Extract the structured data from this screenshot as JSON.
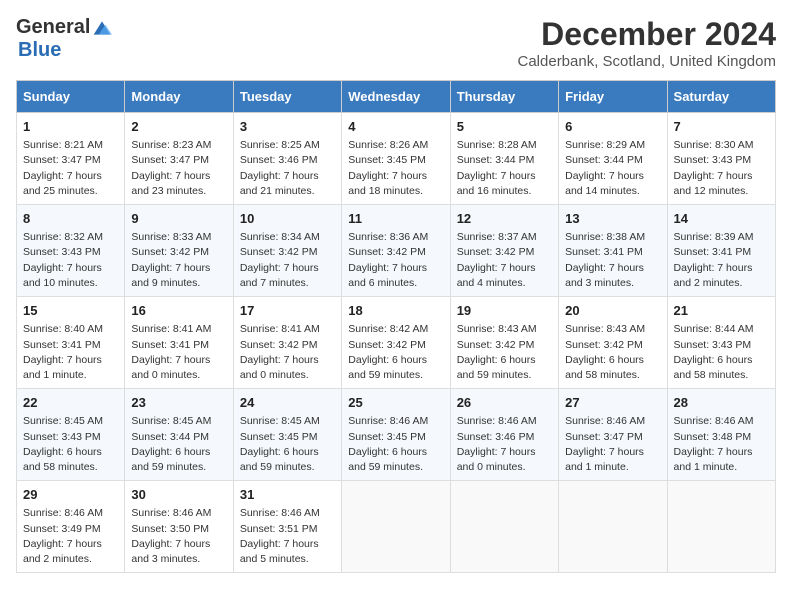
{
  "header": {
    "logo_general": "General",
    "logo_blue": "Blue",
    "month_title": "December 2024",
    "location": "Calderbank, Scotland, United Kingdom"
  },
  "calendar": {
    "columns": [
      "Sunday",
      "Monday",
      "Tuesday",
      "Wednesday",
      "Thursday",
      "Friday",
      "Saturday"
    ],
    "weeks": [
      [
        {
          "day": "1",
          "detail": "Sunrise: 8:21 AM\nSunset: 3:47 PM\nDaylight: 7 hours\nand 25 minutes."
        },
        {
          "day": "2",
          "detail": "Sunrise: 8:23 AM\nSunset: 3:47 PM\nDaylight: 7 hours\nand 23 minutes."
        },
        {
          "day": "3",
          "detail": "Sunrise: 8:25 AM\nSunset: 3:46 PM\nDaylight: 7 hours\nand 21 minutes."
        },
        {
          "day": "4",
          "detail": "Sunrise: 8:26 AM\nSunset: 3:45 PM\nDaylight: 7 hours\nand 18 minutes."
        },
        {
          "day": "5",
          "detail": "Sunrise: 8:28 AM\nSunset: 3:44 PM\nDaylight: 7 hours\nand 16 minutes."
        },
        {
          "day": "6",
          "detail": "Sunrise: 8:29 AM\nSunset: 3:44 PM\nDaylight: 7 hours\nand 14 minutes."
        },
        {
          "day": "7",
          "detail": "Sunrise: 8:30 AM\nSunset: 3:43 PM\nDaylight: 7 hours\nand 12 minutes."
        }
      ],
      [
        {
          "day": "8",
          "detail": "Sunrise: 8:32 AM\nSunset: 3:43 PM\nDaylight: 7 hours\nand 10 minutes."
        },
        {
          "day": "9",
          "detail": "Sunrise: 8:33 AM\nSunset: 3:42 PM\nDaylight: 7 hours\nand 9 minutes."
        },
        {
          "day": "10",
          "detail": "Sunrise: 8:34 AM\nSunset: 3:42 PM\nDaylight: 7 hours\nand 7 minutes."
        },
        {
          "day": "11",
          "detail": "Sunrise: 8:36 AM\nSunset: 3:42 PM\nDaylight: 7 hours\nand 6 minutes."
        },
        {
          "day": "12",
          "detail": "Sunrise: 8:37 AM\nSunset: 3:42 PM\nDaylight: 7 hours\nand 4 minutes."
        },
        {
          "day": "13",
          "detail": "Sunrise: 8:38 AM\nSunset: 3:41 PM\nDaylight: 7 hours\nand 3 minutes."
        },
        {
          "day": "14",
          "detail": "Sunrise: 8:39 AM\nSunset: 3:41 PM\nDaylight: 7 hours\nand 2 minutes."
        }
      ],
      [
        {
          "day": "15",
          "detail": "Sunrise: 8:40 AM\nSunset: 3:41 PM\nDaylight: 7 hours\nand 1 minute."
        },
        {
          "day": "16",
          "detail": "Sunrise: 8:41 AM\nSunset: 3:41 PM\nDaylight: 7 hours\nand 0 minutes."
        },
        {
          "day": "17",
          "detail": "Sunrise: 8:41 AM\nSunset: 3:42 PM\nDaylight: 7 hours\nand 0 minutes."
        },
        {
          "day": "18",
          "detail": "Sunrise: 8:42 AM\nSunset: 3:42 PM\nDaylight: 6 hours\nand 59 minutes."
        },
        {
          "day": "19",
          "detail": "Sunrise: 8:43 AM\nSunset: 3:42 PM\nDaylight: 6 hours\nand 59 minutes."
        },
        {
          "day": "20",
          "detail": "Sunrise: 8:43 AM\nSunset: 3:42 PM\nDaylight: 6 hours\nand 58 minutes."
        },
        {
          "day": "21",
          "detail": "Sunrise: 8:44 AM\nSunset: 3:43 PM\nDaylight: 6 hours\nand 58 minutes."
        }
      ],
      [
        {
          "day": "22",
          "detail": "Sunrise: 8:45 AM\nSunset: 3:43 PM\nDaylight: 6 hours\nand 58 minutes."
        },
        {
          "day": "23",
          "detail": "Sunrise: 8:45 AM\nSunset: 3:44 PM\nDaylight: 6 hours\nand 59 minutes."
        },
        {
          "day": "24",
          "detail": "Sunrise: 8:45 AM\nSunset: 3:45 PM\nDaylight: 6 hours\nand 59 minutes."
        },
        {
          "day": "25",
          "detail": "Sunrise: 8:46 AM\nSunset: 3:45 PM\nDaylight: 6 hours\nand 59 minutes."
        },
        {
          "day": "26",
          "detail": "Sunrise: 8:46 AM\nSunset: 3:46 PM\nDaylight: 7 hours\nand 0 minutes."
        },
        {
          "day": "27",
          "detail": "Sunrise: 8:46 AM\nSunset: 3:47 PM\nDaylight: 7 hours\nand 1 minute."
        },
        {
          "day": "28",
          "detail": "Sunrise: 8:46 AM\nSunset: 3:48 PM\nDaylight: 7 hours\nand 1 minute."
        }
      ],
      [
        {
          "day": "29",
          "detail": "Sunrise: 8:46 AM\nSunset: 3:49 PM\nDaylight: 7 hours\nand 2 minutes."
        },
        {
          "day": "30",
          "detail": "Sunrise: 8:46 AM\nSunset: 3:50 PM\nDaylight: 7 hours\nand 3 minutes."
        },
        {
          "day": "31",
          "detail": "Sunrise: 8:46 AM\nSunset: 3:51 PM\nDaylight: 7 hours\nand 5 minutes."
        },
        null,
        null,
        null,
        null
      ]
    ]
  }
}
